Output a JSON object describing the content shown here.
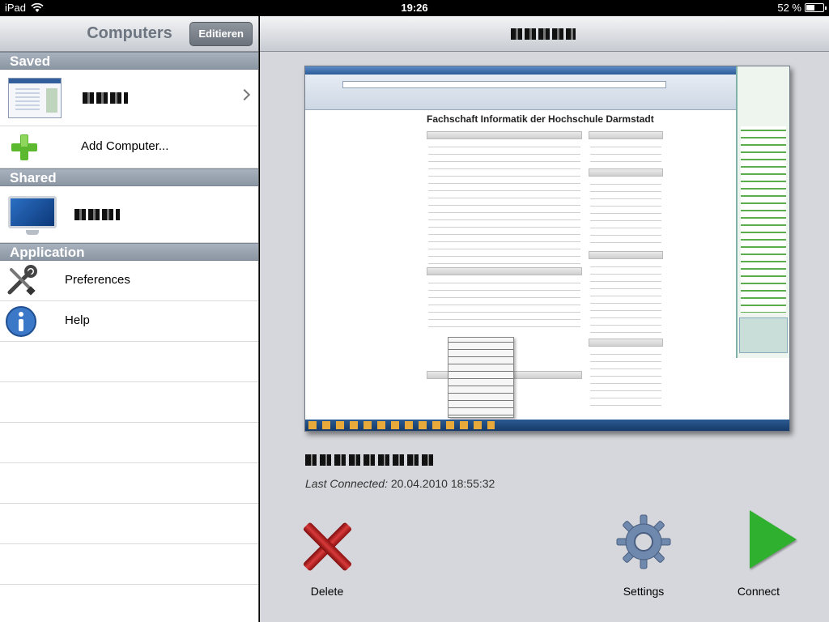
{
  "status_bar": {
    "device": "iPad",
    "time": "19:26",
    "battery": "52 %",
    "battery_level": 0.52
  },
  "sidebar": {
    "title": "Computers",
    "edit_label": "Editieren",
    "sections": {
      "saved": "Saved",
      "shared": "Shared",
      "application": "Application"
    },
    "add_computer": "Add Computer...",
    "preferences": "Preferences",
    "help": "Help"
  },
  "detail": {
    "last_connected_label": "Last Connected:",
    "last_connected_value": "20.04.2010 18:55:32",
    "preview_heading": "Fachschaft Informatik der Hochschule Darmstadt",
    "actions": {
      "delete": "Delete",
      "settings": "Settings",
      "connect": "Connect"
    }
  },
  "icons": {
    "saved_computer": "screen-thumbnail",
    "add": "plus-icon",
    "shared_computer": "monitor-icon",
    "preferences": "tools-icon",
    "help": "info-icon",
    "delete": "x-icon",
    "settings": "gear-icon",
    "connect": "play-icon"
  },
  "colors": {
    "accent_green": "#2fb02f",
    "delete_red": "#c62828",
    "section_header": "#97a3b0"
  }
}
